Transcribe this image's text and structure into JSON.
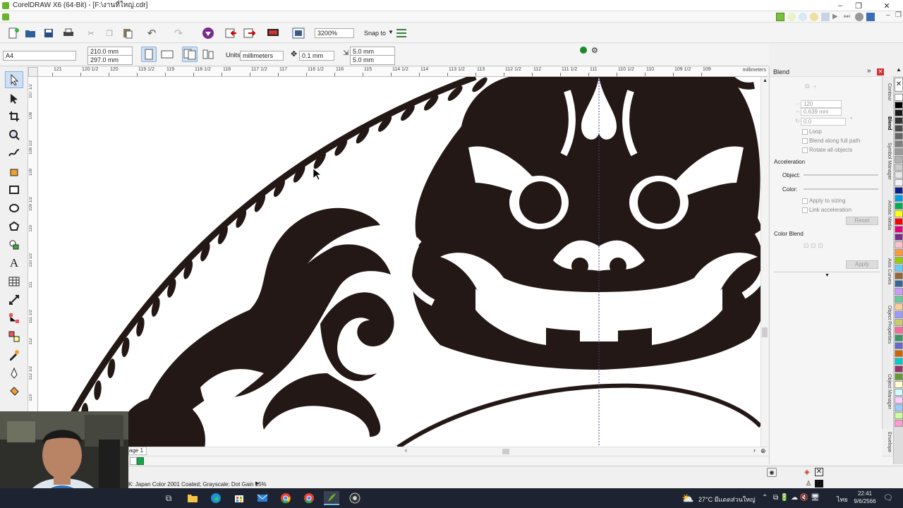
{
  "window": {
    "title": "CorelDRAW X6 (64-Bit) - [F:\\งานที่ใหญ่.cdr]",
    "minimize": "–",
    "restore": "❐",
    "close": "✕"
  },
  "toolbar": {
    "zoom": "3200%",
    "snap_to": "Snap to"
  },
  "propertybar": {
    "paper_size": "A4",
    "width": "210.0 mm",
    "height": "297.0 mm",
    "units_label": "Units:",
    "units": "millimeters",
    "nudge": "0.1 mm",
    "dup_x": "5.0 mm",
    "dup_y": "5.0 mm"
  },
  "ruler": {
    "h_ticks": [
      "121",
      "120 1/2",
      "120",
      "119 1/2",
      "119",
      "118 1/2",
      "118",
      "117 1/2",
      "117",
      "116 1/2",
      "116",
      "115",
      "114 1/2",
      "114",
      "113 1/2",
      "113",
      "112 1/2",
      "112",
      "111 1/2",
      "111",
      "110 1/2",
      "110",
      "109 1/2",
      "109"
    ],
    "h_unit": "millimeters",
    "v_ticks": [
      "107 1/2",
      "108",
      "108 1/2",
      "109",
      "109 1/2",
      "110",
      "110 1/2",
      "111",
      "111 1/2",
      "112",
      "112 1/2",
      "113",
      "113 1/2"
    ]
  },
  "page_tab": "age 1",
  "status": {
    "color_profile": "K: Japan Color 2001 Coated; Grayscale: Dot Gain 15%"
  },
  "docker": {
    "title": "Blend",
    "steps": "120",
    "spacing": "0.639 mm",
    "rotation": "0.0",
    "loop": "Loop",
    "blend_along": "Blend along full path",
    "rotate_all": "Rotate all objects",
    "acceleration": "Acceleration",
    "object": "Object:",
    "color": "Color:",
    "apply_sizing": "Apply to sizing",
    "link_accel": "Link acceleration",
    "reset": "Reset",
    "color_blend": "Color Blend",
    "apply": "Apply"
  },
  "docker_tabs": [
    "Contour",
    "Blend",
    "Symbol Manager",
    "Artistic Media",
    "Axis Curves",
    "Object Properties",
    "Object Manager",
    "Envelope"
  ],
  "palette_colors": [
    "#ffffff",
    "#000000",
    "#1a1a1a",
    "#333333",
    "#4d4d4d",
    "#666666",
    "#808080",
    "#999999",
    "#b3b3b3",
    "#cccccc",
    "#e6e6e6",
    "#f2f2f2",
    "#0a1f8f",
    "#00a0e9",
    "#00b050",
    "#ffff00",
    "#ff0000",
    "#e4007f",
    "#7b2c8b",
    "#ffc0cb",
    "#ff9933",
    "#99cc00",
    "#66ccff",
    "#996633",
    "#336699",
    "#cc99ff",
    "#66cc99",
    "#ffcc99",
    "#9999ff",
    "#cccc66",
    "#ff6699",
    "#339966",
    "#6666cc",
    "#cc6600",
    "#00cccc",
    "#993366",
    "#669933",
    "#ffffcc",
    "#ccffff",
    "#ffccff",
    "#99ccff",
    "#ccff99",
    "#ff99cc"
  ],
  "taskbar": {
    "weather": "27°C มีแดดส่วนใหญ่",
    "lang": "ไทย",
    "time": "22:41",
    "date": "9/6/2566"
  }
}
